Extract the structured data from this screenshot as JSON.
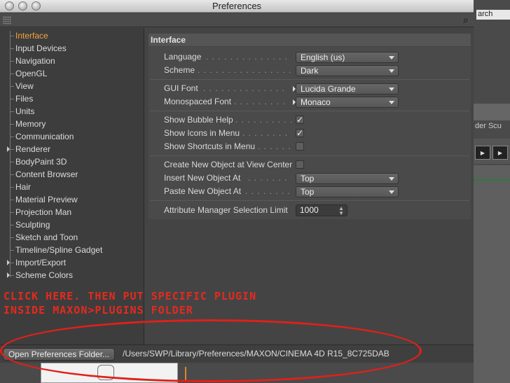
{
  "window": {
    "title": "Preferences"
  },
  "background_app": {
    "search_text": "arch",
    "tabs_text": "der   Scu"
  },
  "sidebar": {
    "items": [
      {
        "label": "Interface",
        "active": true,
        "expandable": false
      },
      {
        "label": "Input Devices",
        "active": false,
        "expandable": false
      },
      {
        "label": "Navigation",
        "active": false,
        "expandable": false
      },
      {
        "label": "OpenGL",
        "active": false,
        "expandable": false
      },
      {
        "label": "View",
        "active": false,
        "expandable": false
      },
      {
        "label": "Files",
        "active": false,
        "expandable": false
      },
      {
        "label": "Units",
        "active": false,
        "expandable": false
      },
      {
        "label": "Memory",
        "active": false,
        "expandable": false
      },
      {
        "label": "Communication",
        "active": false,
        "expandable": false
      },
      {
        "label": "Renderer",
        "active": false,
        "expandable": true
      },
      {
        "label": "BodyPaint 3D",
        "active": false,
        "expandable": false
      },
      {
        "label": "Content Browser",
        "active": false,
        "expandable": false
      },
      {
        "label": "Hair",
        "active": false,
        "expandable": false
      },
      {
        "label": "Material Preview",
        "active": false,
        "expandable": false
      },
      {
        "label": "Projection Man",
        "active": false,
        "expandable": false
      },
      {
        "label": "Sculpting",
        "active": false,
        "expandable": false
      },
      {
        "label": "Sketch and Toon",
        "active": false,
        "expandable": false
      },
      {
        "label": "Timeline/Spline Gadget",
        "active": false,
        "expandable": false
      },
      {
        "label": "Import/Export",
        "active": false,
        "expandable": true
      },
      {
        "label": "Scheme Colors",
        "active": false,
        "expandable": true
      }
    ]
  },
  "panel": {
    "header": "Interface",
    "settings": {
      "language": {
        "label": "Language",
        "value": "English (us)"
      },
      "scheme": {
        "label": "Scheme",
        "value": "Dark"
      },
      "gui_font": {
        "label": "GUI Font",
        "value": "Lucida Grande"
      },
      "mono_font": {
        "label": "Monospaced Font",
        "value": "Monaco"
      },
      "bubble_help": {
        "label": "Show Bubble Help",
        "checked": true
      },
      "icons_menu": {
        "label": "Show Icons in Menu",
        "checked": true
      },
      "shortcuts_menu": {
        "label": "Show Shortcuts in Menu",
        "checked": false
      },
      "new_object_center": {
        "label": "Create New Object at View Center",
        "checked": false
      },
      "insert_new_object": {
        "label": "Insert New Object At",
        "value": "Top"
      },
      "paste_new_object": {
        "label": "Paste New Object At",
        "value": "Top"
      },
      "attr_limit": {
        "label": "Attribute Manager Selection Limit",
        "value": "1000"
      }
    }
  },
  "annotation": {
    "line1": "CLICK HERE. THEN PUT SPECIFIC PLUGIN",
    "line2": "INSIDE MAXON>PLUGINS FOLDER",
    "color": "#e52a1e"
  },
  "bottom": {
    "open_folder_label": "Open Preferences Folder...",
    "path": "/Users/SWP/Library/Preferences/MAXON/CINEMA 4D R15_8C725DAB"
  },
  "colors": {
    "accent_active": "#f0a53a",
    "window_bg": "#444444",
    "annotation_red": "#e0201a"
  }
}
